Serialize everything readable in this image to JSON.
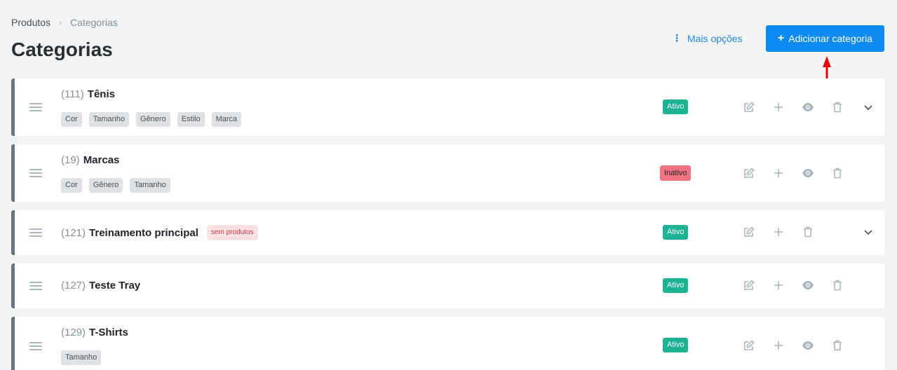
{
  "breadcrumb": {
    "root": "Produtos",
    "current": "Categorias"
  },
  "page": {
    "title": "Categorias"
  },
  "toolbar": {
    "more_options": "Mais opções",
    "add_category": "Adicionar categoria"
  },
  "categories": [
    {
      "code": "(111)",
      "name": "Tênis",
      "tags": [
        "Cor",
        "Tamanho",
        "Gênero",
        "Estilo",
        "Marca"
      ],
      "status": "Ativo"
    },
    {
      "code": "(19)",
      "name": "Marcas",
      "tags": [
        "Cor",
        "Gênero",
        "Tamanho"
      ],
      "status": "Inativo"
    },
    {
      "code": "(121)",
      "name": "Treinamento principal",
      "badge": "sem produtos",
      "status": "Ativo"
    },
    {
      "code": "(127)",
      "name": "Teste Tray",
      "status": "Ativo"
    },
    {
      "code": "(129)",
      "name": "T-Shirts",
      "tags": [
        "Tamanho"
      ],
      "status": "Ativo"
    }
  ],
  "colors": {
    "accent": "#0d8bf2",
    "active": "#1bb394",
    "inactive": "#f07482",
    "arrow": "#e8000b"
  }
}
